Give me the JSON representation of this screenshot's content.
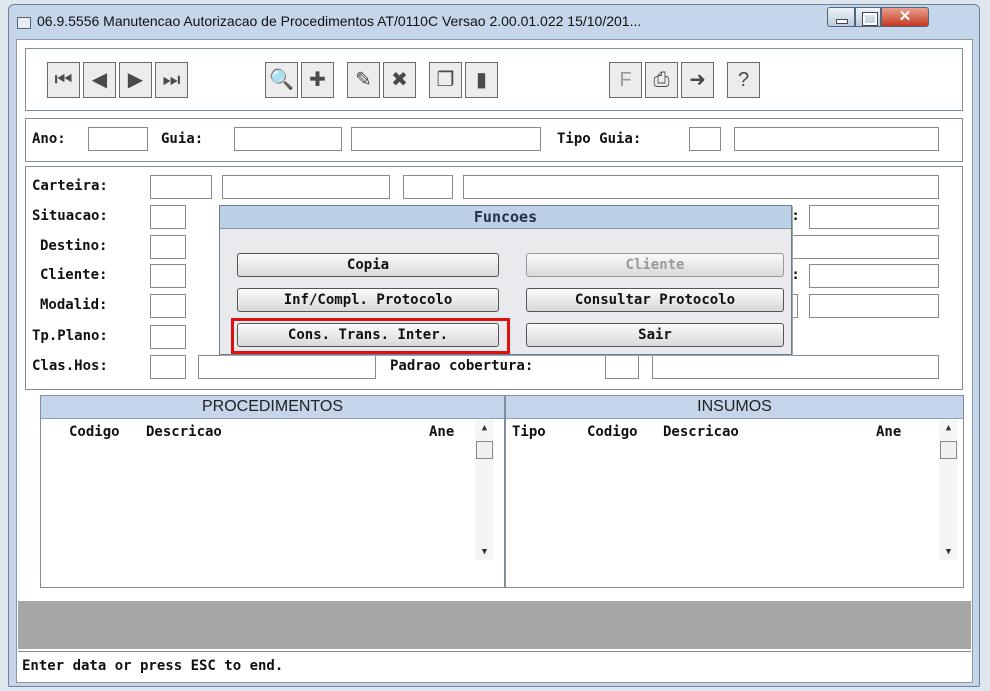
{
  "window": {
    "title": "06.9.5556 Manutencao Autorizacao de Procedimentos AT/0110C Versao 2.00.01.022 15/10/201..."
  },
  "toolbar": {
    "nav": [
      {
        "name": "first-record-button",
        "icon": "first-icon",
        "glyph": "⏮"
      },
      {
        "name": "prev-record-button",
        "icon": "prev-icon",
        "glyph": "◀"
      },
      {
        "name": "next-record-button",
        "icon": "next-icon",
        "glyph": "▶"
      },
      {
        "name": "last-record-button",
        "icon": "last-icon",
        "glyph": "⏭"
      }
    ],
    "actions": [
      {
        "name": "search-button",
        "icon": "search-icon",
        "glyph": "🔍"
      },
      {
        "name": "add-button",
        "icon": "add-icon",
        "glyph": "✚"
      },
      {
        "name": "edit-button",
        "icon": "edit-icon",
        "glyph": "✎"
      },
      {
        "name": "delete-button",
        "icon": "delete-icon",
        "glyph": "✖"
      },
      {
        "name": "copy-button",
        "icon": "copy-icon",
        "glyph": "❐"
      },
      {
        "name": "open-button",
        "icon": "door-icon",
        "glyph": "▮"
      }
    ],
    "utils": [
      {
        "name": "filter-button",
        "icon": "filter-icon",
        "glyph": "F"
      },
      {
        "name": "print-button",
        "icon": "print-icon",
        "glyph": "⎙"
      },
      {
        "name": "exit-button",
        "icon": "exit-icon",
        "glyph": "➜"
      },
      {
        "name": "help-button",
        "icon": "help-icon",
        "glyph": "?"
      }
    ]
  },
  "header": {
    "ano_label": "Ano:",
    "guia_label": "Guia:",
    "tipo_guia_label": "Tipo Guia:"
  },
  "form": {
    "carteira": "Carteira:",
    "situacao": "Situacao:",
    "destino": "Destino:",
    "cliente": "Cliente:",
    "modalid": "Modalid:",
    "tp_plano": "Tp.Plano:",
    "clas_hos": "Clas.Hos:",
    "padrao_cobertura": "Padrao cobertura:",
    "partial_d": "d:",
    "partial_o": "o:"
  },
  "dialog": {
    "title": "Funcoes",
    "buttons": {
      "copia": "Copia",
      "cliente": "Cliente",
      "inf_compl": "Inf/Compl. Protocolo",
      "consultar": "Consultar Protocolo",
      "cons_trans": "Cons. Trans. Inter.",
      "sair": "Sair"
    }
  },
  "procedimentos": {
    "title": "PROCEDIMENTOS",
    "col_codigo": "Codigo",
    "col_descricao": "Descricao",
    "col_ane": "Ane"
  },
  "insumos": {
    "title": "INSUMOS",
    "col_tipo": "Tipo",
    "col_codigo": "Codigo",
    "col_descricao": "Descricao",
    "col_ane": "Ane"
  },
  "scroll": {
    "up": "▲",
    "down": "▼"
  },
  "status": {
    "message": "Enter data or press ESC to end."
  },
  "colors": {
    "highlight": "#e01010",
    "title_bar": "#c5d6ea",
    "close_button": "#c43a22"
  }
}
